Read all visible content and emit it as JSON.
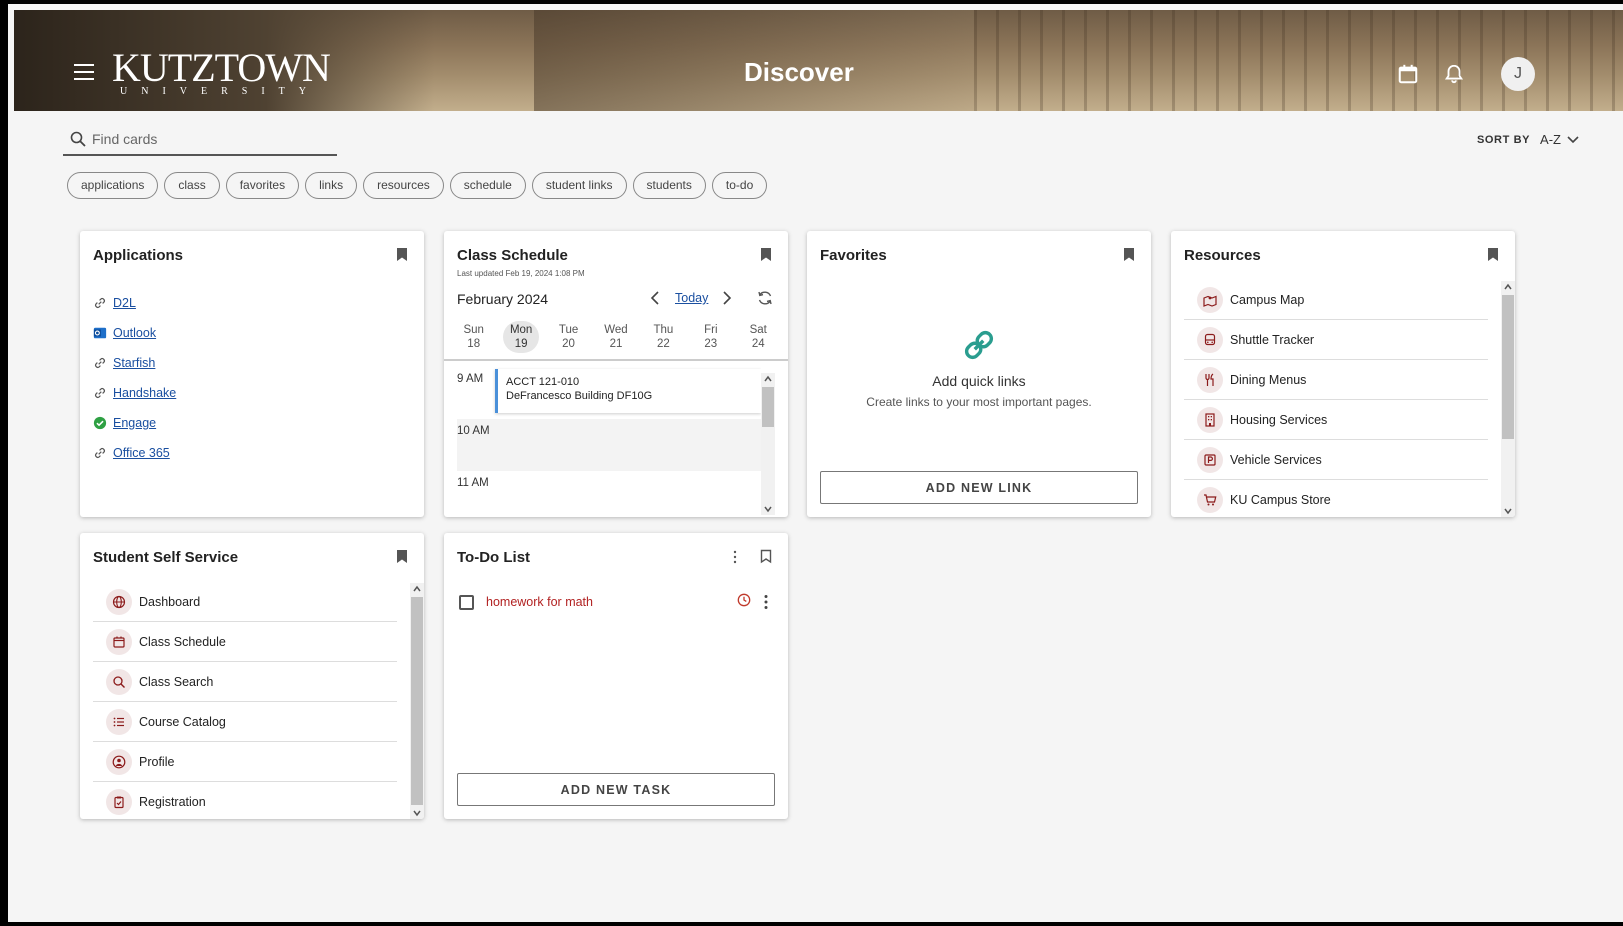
{
  "header": {
    "logo_main": "KUTZTOWN",
    "logo_sub": "UNIVERSITY",
    "title": "Discover",
    "avatar_initial": "J"
  },
  "search": {
    "placeholder": "Find cards"
  },
  "sort": {
    "label": "SORT BY",
    "value": "A-Z"
  },
  "filters": [
    "applications",
    "class",
    "favorites",
    "links",
    "resources",
    "schedule",
    "student links",
    "students",
    "to-do"
  ],
  "applications": {
    "title": "Applications",
    "items": [
      {
        "label": "D2L",
        "icon": "link-icon"
      },
      {
        "label": "Outlook",
        "icon": "outlook-icon"
      },
      {
        "label": "Starfish",
        "icon": "link-icon"
      },
      {
        "label": "Handshake",
        "icon": "link-icon"
      },
      {
        "label": "Engage",
        "icon": "engage-icon"
      },
      {
        "label": "Office 365",
        "icon": "link-icon"
      }
    ]
  },
  "schedule": {
    "title": "Class Schedule",
    "updated": "Last updated Feb 19, 2024 1:08 PM",
    "month": "February 2024",
    "today_label": "Today",
    "days": [
      {
        "name": "Sun",
        "num": "18"
      },
      {
        "name": "Mon",
        "num": "19"
      },
      {
        "name": "Tue",
        "num": "20"
      },
      {
        "name": "Wed",
        "num": "21"
      },
      {
        "name": "Thu",
        "num": "22"
      },
      {
        "name": "Fri",
        "num": "23"
      },
      {
        "name": "Sat",
        "num": "24"
      }
    ],
    "times": [
      "9 AM",
      "10 AM",
      "11 AM"
    ],
    "event": {
      "course": "ACCT 121-010",
      "location": "DeFrancesco Building DF10G"
    }
  },
  "favorites": {
    "title": "Favorites",
    "empty_title": "Add quick links",
    "empty_desc": "Create links to your most important pages.",
    "button": "ADD NEW LINK"
  },
  "resources": {
    "title": "Resources",
    "items": [
      {
        "label": "Campus Map",
        "icon": "map-icon"
      },
      {
        "label": "Shuttle Tracker",
        "icon": "bus-icon"
      },
      {
        "label": "Dining Menus",
        "icon": "utensils-icon"
      },
      {
        "label": "Housing Services",
        "icon": "building-icon"
      },
      {
        "label": "Vehicle Services",
        "icon": "parking-icon"
      },
      {
        "label": "KU Campus Store",
        "icon": "cart-icon"
      }
    ]
  },
  "self_service": {
    "title": "Student Self Service",
    "items": [
      {
        "label": "Dashboard",
        "icon": "globe-icon"
      },
      {
        "label": "Class Schedule",
        "icon": "calendar-icon"
      },
      {
        "label": "Class Search",
        "icon": "search-icon"
      },
      {
        "label": "Course Catalog",
        "icon": "list-icon"
      },
      {
        "label": "Profile",
        "icon": "profile-icon"
      },
      {
        "label": "Registration",
        "icon": "clipboard-icon"
      }
    ]
  },
  "todo": {
    "title": "To-Do List",
    "items": [
      {
        "text": "homework for math"
      }
    ],
    "button": "ADD NEW TASK"
  },
  "colors": {
    "accent_maroon": "#8b1a1a",
    "link_blue": "#1a4fa0",
    "todo_red": "#b22222",
    "event_blue": "#4a90d9"
  }
}
